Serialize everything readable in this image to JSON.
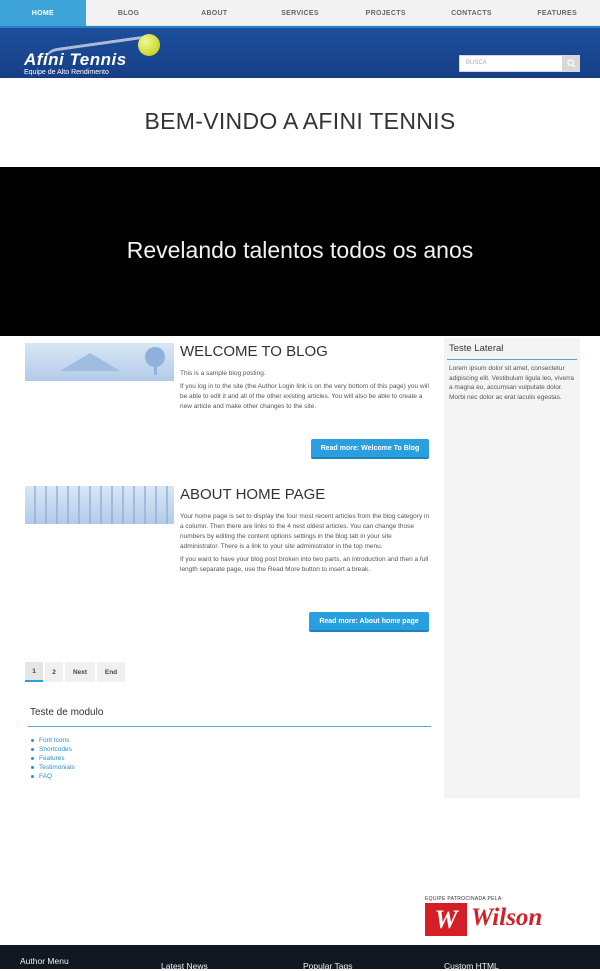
{
  "nav": {
    "items": [
      {
        "label": "HOME",
        "active": true
      },
      {
        "label": "BLOG"
      },
      {
        "label": "ABOUT"
      },
      {
        "label": "SERVICES"
      },
      {
        "label": "PROJECTS"
      },
      {
        "label": "CONTACTS"
      },
      {
        "label": "FEATURES"
      }
    ]
  },
  "header": {
    "brand": "Afini Tennis",
    "tagline": "Equipe de Alto Rendimento",
    "search_placeholder": "BUSCA"
  },
  "welcome": {
    "title": "BEM-VINDO A AFINI TENNIS"
  },
  "hero": {
    "caption": "Revelando talentos todos os anos"
  },
  "articles": [
    {
      "title": "WELCOME TO BLOG",
      "paragraphs": [
        "This is a sample blog posting.",
        "If you log in to the site (the Author Login link is on the very bottom of this page) you will be able to edit it and all of the other existing articles. You will also be able to create a new article and make other changes to the site."
      ],
      "button": "Read more: Welcome To Blog"
    },
    {
      "title": "ABOUT HOME PAGE",
      "paragraphs": [
        "Your home page is set to display the four most recent articles from the blog category in a column. Then there are links to the 4 nest oldest articles. You can change those numbers by editing the content options settings in the blog tab in your site administrator. There is a link to your site administrator in the top menu.",
        "If you want to have your blog post broken into two parts, an introduction and then a full length separate page, use the Read More button to insert a break."
      ],
      "button": "Read more: About home page"
    }
  ],
  "pagination": {
    "items": [
      "1",
      "2",
      "Next",
      "End"
    ],
    "current": "1"
  },
  "module": {
    "title": "Teste de modulo",
    "links": [
      "Font Icons",
      "Shortcodes",
      "Features",
      "Testimonials",
      "FAQ"
    ]
  },
  "sidebar": {
    "title": "Teste Lateral",
    "text": "Lorem ipsum dolor sit amet, consectetur adipiscing elit. Vestibulum ligula leo, viverra a magna eu, accumsan vulputate dolor. Morbi nec dolor ac erat iaculis egestas."
  },
  "sponsor": {
    "caption": "EQUIPE PATROCINADA PELA:",
    "mark": "W",
    "name": "Wilson"
  },
  "footer": {
    "columns": [
      "Author Menu",
      "Latest News",
      "Popular Tags",
      "Custom HTML"
    ]
  },
  "colors": {
    "accent": "#2a9fe0",
    "header": "#1d4f9c",
    "sponsor_red": "#d51f26"
  }
}
